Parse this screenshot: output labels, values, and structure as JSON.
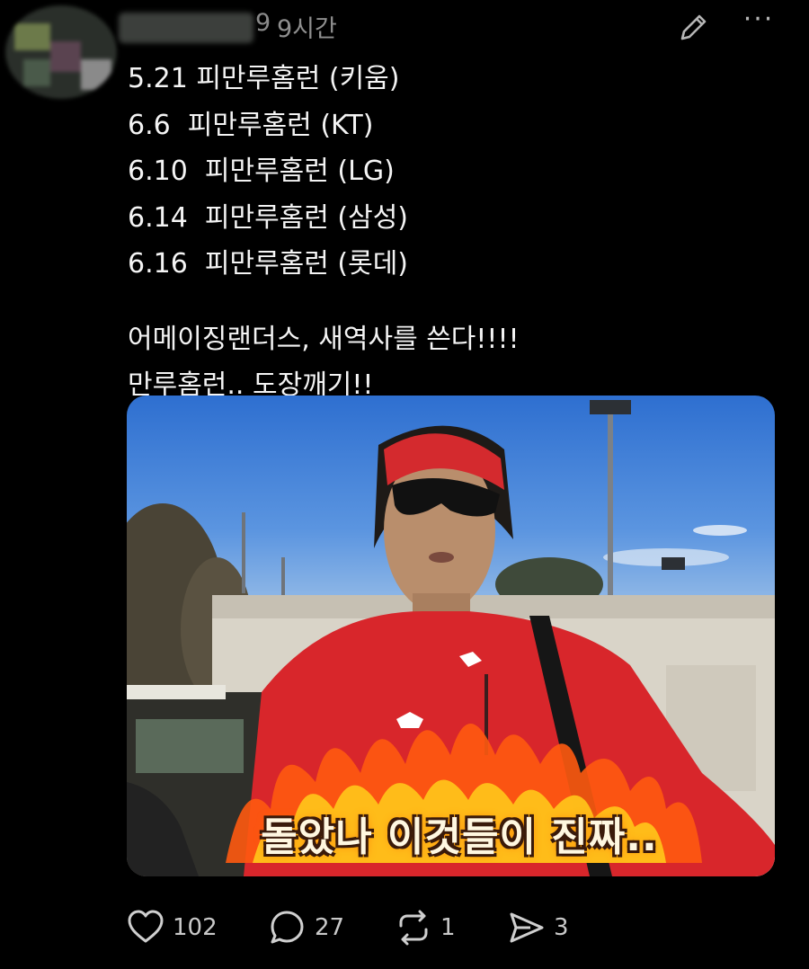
{
  "header": {
    "handle_tail": "9",
    "time": "9시간",
    "edit_icon": "pencil-icon",
    "more_icon": "more-icon",
    "more_label": "···"
  },
  "post": {
    "lines": [
      "5.21 피만루홈런 (키움)",
      "6.6  피만루홈런 (KT)",
      "6.10  피만루홈런 (LG)",
      "6.14  피만루홈런 (삼성)",
      "6.16  피만루홈런 (롯데)"
    ],
    "comment_lines": [
      "어메이징랜더스, 새역사를 쓴다!!!!",
      "만루홈런.. 도장깨기!!"
    ]
  },
  "media": {
    "caption": "돌았나 이것들이 진짜..",
    "colors": {
      "jersey": "#d8262b",
      "sky": "#3f7fd8"
    }
  },
  "actions": {
    "likes": "102",
    "replies": "27",
    "reposts": "1",
    "shares": "3",
    "icons": [
      "heart-icon",
      "reply-icon",
      "repost-icon",
      "share-icon"
    ]
  }
}
